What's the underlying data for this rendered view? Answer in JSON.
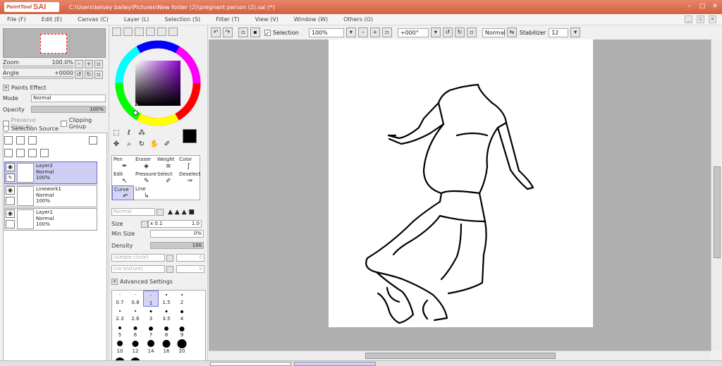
{
  "titlebar": {
    "logo_small": "PaintTool",
    "logo_big": "SAI",
    "title": "C:\\Users\\kelsey bailey\\Pictures\\New folder (2)\\pregnant person  (2).sai (*)",
    "minimize": "–",
    "maximize": "□",
    "close": "✕"
  },
  "menu": [
    "File (F)",
    "Edit (E)",
    "Canvas (C)",
    "Layer (L)",
    "Selection (S)",
    "Filter (T)",
    "View (V)",
    "Window (W)",
    "Others (O)"
  ],
  "navigator": {
    "zoom_label": "Zoom",
    "zoom_value": "100.0%",
    "angle_label": "Angle",
    "angle_value": "+0000"
  },
  "layer_props": {
    "paints_effect": "Paints Effect",
    "mode_label": "Mode",
    "mode_value": "Normal",
    "opacity_label": "Opacity",
    "opacity_value": "100%",
    "preserve_opacity": "Preserve Opacity",
    "clipping_group": "Clipping Group",
    "selection_source": "Selection Source"
  },
  "layers": [
    {
      "name": "Layer2",
      "mode": "Normal",
      "opacity": "100%",
      "selected": true
    },
    {
      "name": "Linework1",
      "mode": "Normal",
      "opacity": "100%",
      "selected": false
    },
    {
      "name": "Layer1",
      "mode": "Normal",
      "opacity": "100%",
      "selected": false
    }
  ],
  "brushes": [
    {
      "label": "Pen",
      "glyph": "✒"
    },
    {
      "label": "Eraser",
      "glyph": "◈"
    },
    {
      "label": "Weight",
      "glyph": "≡"
    },
    {
      "label": "Color",
      "glyph": "ʃ"
    },
    {
      "label": "Edit",
      "glyph": "↖"
    },
    {
      "label": "Pressure",
      "glyph": "✎"
    },
    {
      "label": "Select",
      "glyph": "✐"
    },
    {
      "label": "Deselect",
      "glyph": "✑"
    },
    {
      "label": "Curve",
      "glyph": "↶"
    },
    {
      "label": "Line",
      "glyph": "↳"
    },
    {
      "label": "",
      "glyph": ""
    },
    {
      "label": "",
      "glyph": ""
    }
  ],
  "brush_settings": {
    "blend_mode": "Normal",
    "size_label": "Size",
    "size_mult": "x 0.1",
    "size_value": "1.0",
    "min_size_label": "Min Size",
    "min_size_value": "0%",
    "density_label": "Density",
    "density_value": "100",
    "shape": "(simple circle)",
    "shape_value": "0",
    "texture": "(no texture)",
    "texture_value": "0",
    "advanced": "Advanced Settings"
  },
  "pen_sizes": [
    "0.7",
    "0.8",
    "1",
    "1.5",
    "2",
    "2.3",
    "2.6",
    "3",
    "3.5",
    "4",
    "5",
    "6",
    "7",
    "8",
    "9",
    "10",
    "12",
    "14",
    "16",
    "20",
    "",
    ""
  ],
  "toolbar": {
    "selection_label": "Selection",
    "zoom": "100%",
    "rotation": "+000°",
    "blend": "Normal",
    "stabilizer_label": "Stabilizer",
    "stabilizer_value": "12"
  },
  "colors": {
    "accent": "#d2603f",
    "selected_layer": "#cfcff5",
    "canvas_bg": "#b0b0b0",
    "foreground": "#000000",
    "background": "#ffffff"
  }
}
